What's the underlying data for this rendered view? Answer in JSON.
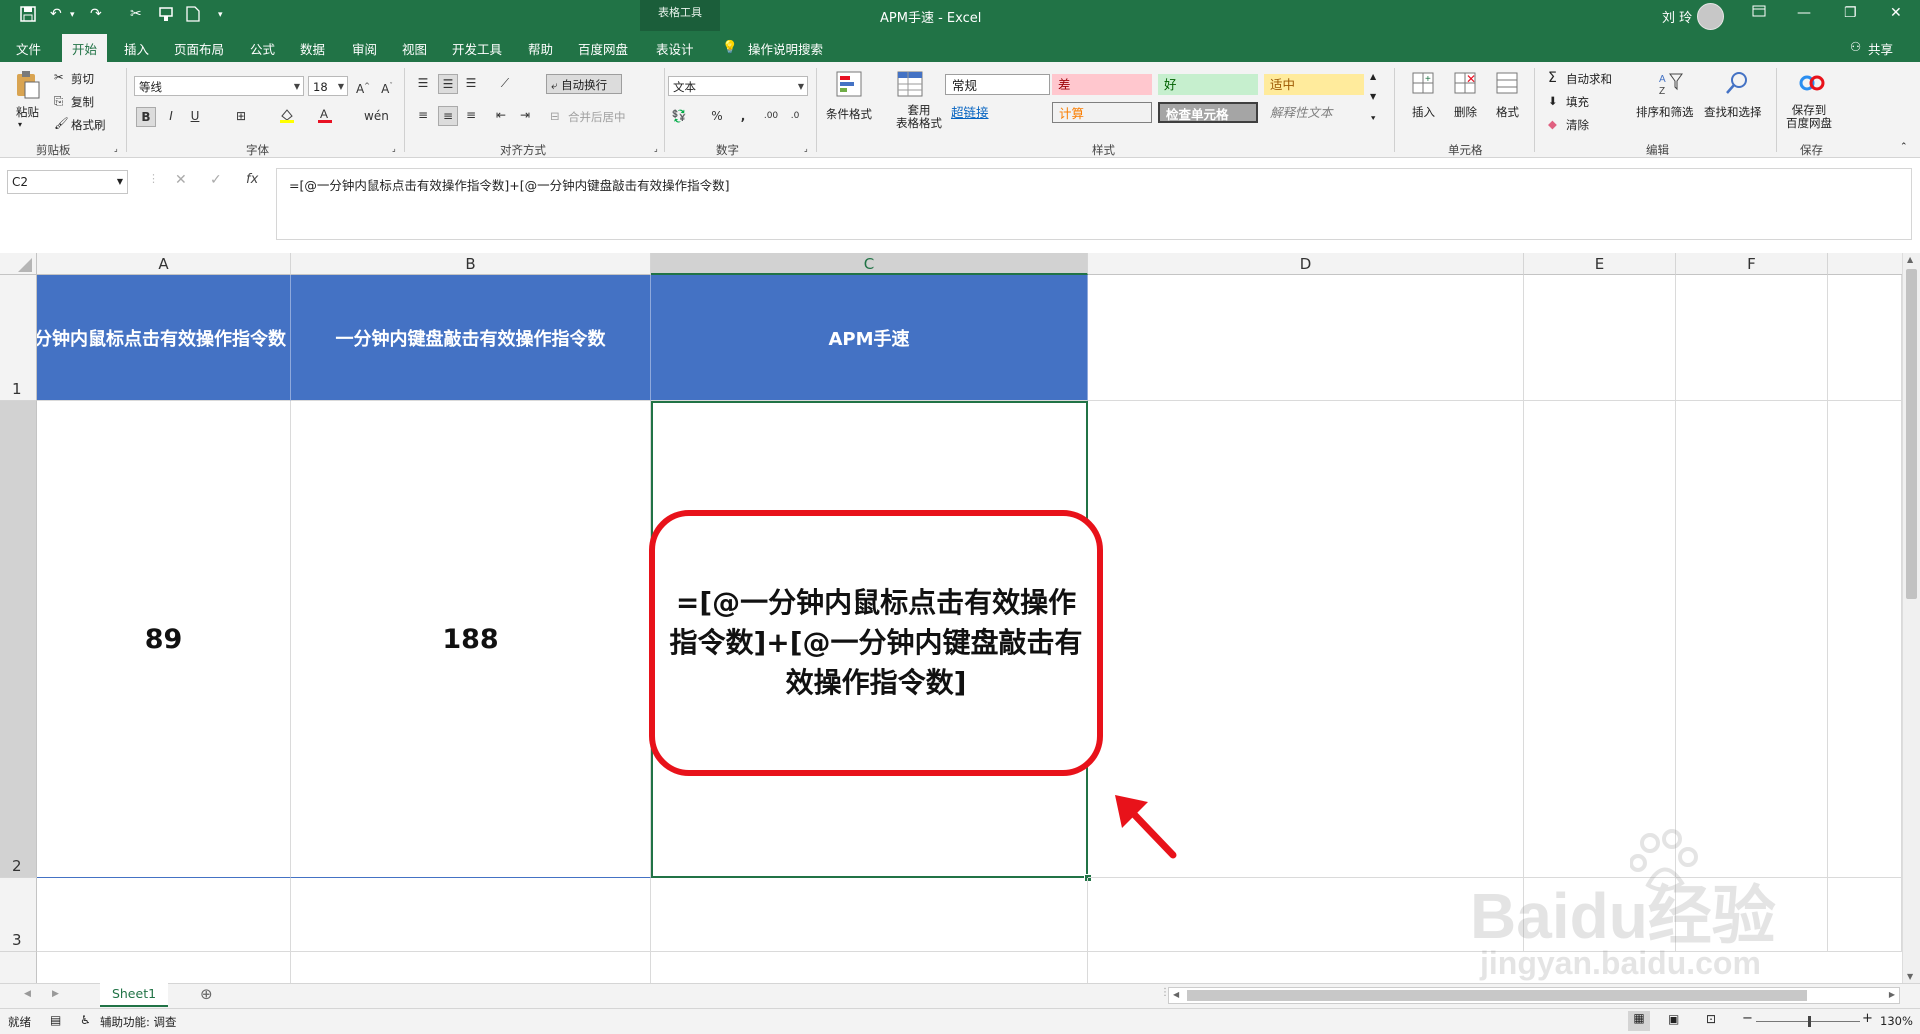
{
  "title_bar": {
    "qat_icons": [
      "save-icon",
      "undo-icon",
      "redo-icon",
      "cut-icon",
      "format-painter-icon",
      "new-icon",
      "customize-icon"
    ],
    "context_tab": "表格工具",
    "document_title": "APM手速 - Excel",
    "user_name": "刘 玲",
    "window_controls": [
      "ribbon-display-icon",
      "minimize-icon",
      "restore-icon",
      "close-icon"
    ]
  },
  "tabs": [
    "文件",
    "开始",
    "插入",
    "页面布局",
    "公式",
    "数据",
    "审阅",
    "视图",
    "开发工具",
    "帮助",
    "百度网盘",
    "表设计"
  ],
  "active_tab": "开始",
  "tell_me": "操作说明搜索",
  "share": "共享",
  "ribbon": {
    "clipboard": {
      "paste": "粘贴",
      "cut": "剪切",
      "copy": "复制",
      "format_painter": "格式刷",
      "label": "剪贴板"
    },
    "font": {
      "name": "等线",
      "size": "18",
      "bold": "B",
      "italic": "I",
      "underline": "U",
      "label": "字体"
    },
    "alignment": {
      "wrap_text": "自动换行",
      "merge_center": "合并后居中",
      "label": "对齐方式"
    },
    "number": {
      "format": "文本",
      "percent": "%",
      "comma": ",",
      "label": "数字"
    },
    "styles": {
      "conditional_format": "条件格式",
      "format_as_table": "套用\n表格格式",
      "cells": [
        "常规",
        "差",
        "好",
        "适中",
        "超链接",
        "计算",
        "检查单元格",
        "解释性文本"
      ],
      "label": "样式"
    },
    "cells_group": {
      "insert": "插入",
      "delete": "删除",
      "format": "格式",
      "label": "单元格"
    },
    "editing": {
      "autosum": "自动求和",
      "fill": "填充",
      "clear": "清除",
      "sort_filter": "排序和筛选",
      "find_select": "查找和选择",
      "label": "编辑"
    },
    "save_group": {
      "save_baidu": "保存到\n百度网盘",
      "label": "保存"
    }
  },
  "formula_bar": {
    "name_box": "C2",
    "fx": "fx",
    "formula": "=[@一分钟内鼠标点击有效操作指令数]+[@一分钟内键盘敲击有效操作指令数]"
  },
  "columns": [
    "A",
    "B",
    "C",
    "D",
    "E",
    "F"
  ],
  "rows": [
    "1",
    "2",
    "3"
  ],
  "table": {
    "headers": [
      "一分钟内鼠标点击有效操作指令数",
      "一分钟内键盘敲击有效操作指令数",
      "APM手速"
    ],
    "values": [
      "89",
      "188",
      "=[@一分钟内鼠标点击有效操作指令数]+[@一分钟内键盘敲击有效操作指令数]"
    ]
  },
  "sheet_tabs": [
    "Sheet1"
  ],
  "status_bar": {
    "ready": "就绪",
    "accessibility": "辅助功能: 调查",
    "zoom": "130%"
  },
  "watermark": {
    "brand": "Baidu经验",
    "url": "jingyan.baidu.com"
  },
  "colors": {
    "excel_green": "#217346",
    "table_header_blue": "#4472c4",
    "annotation_red": "#e8121a"
  }
}
